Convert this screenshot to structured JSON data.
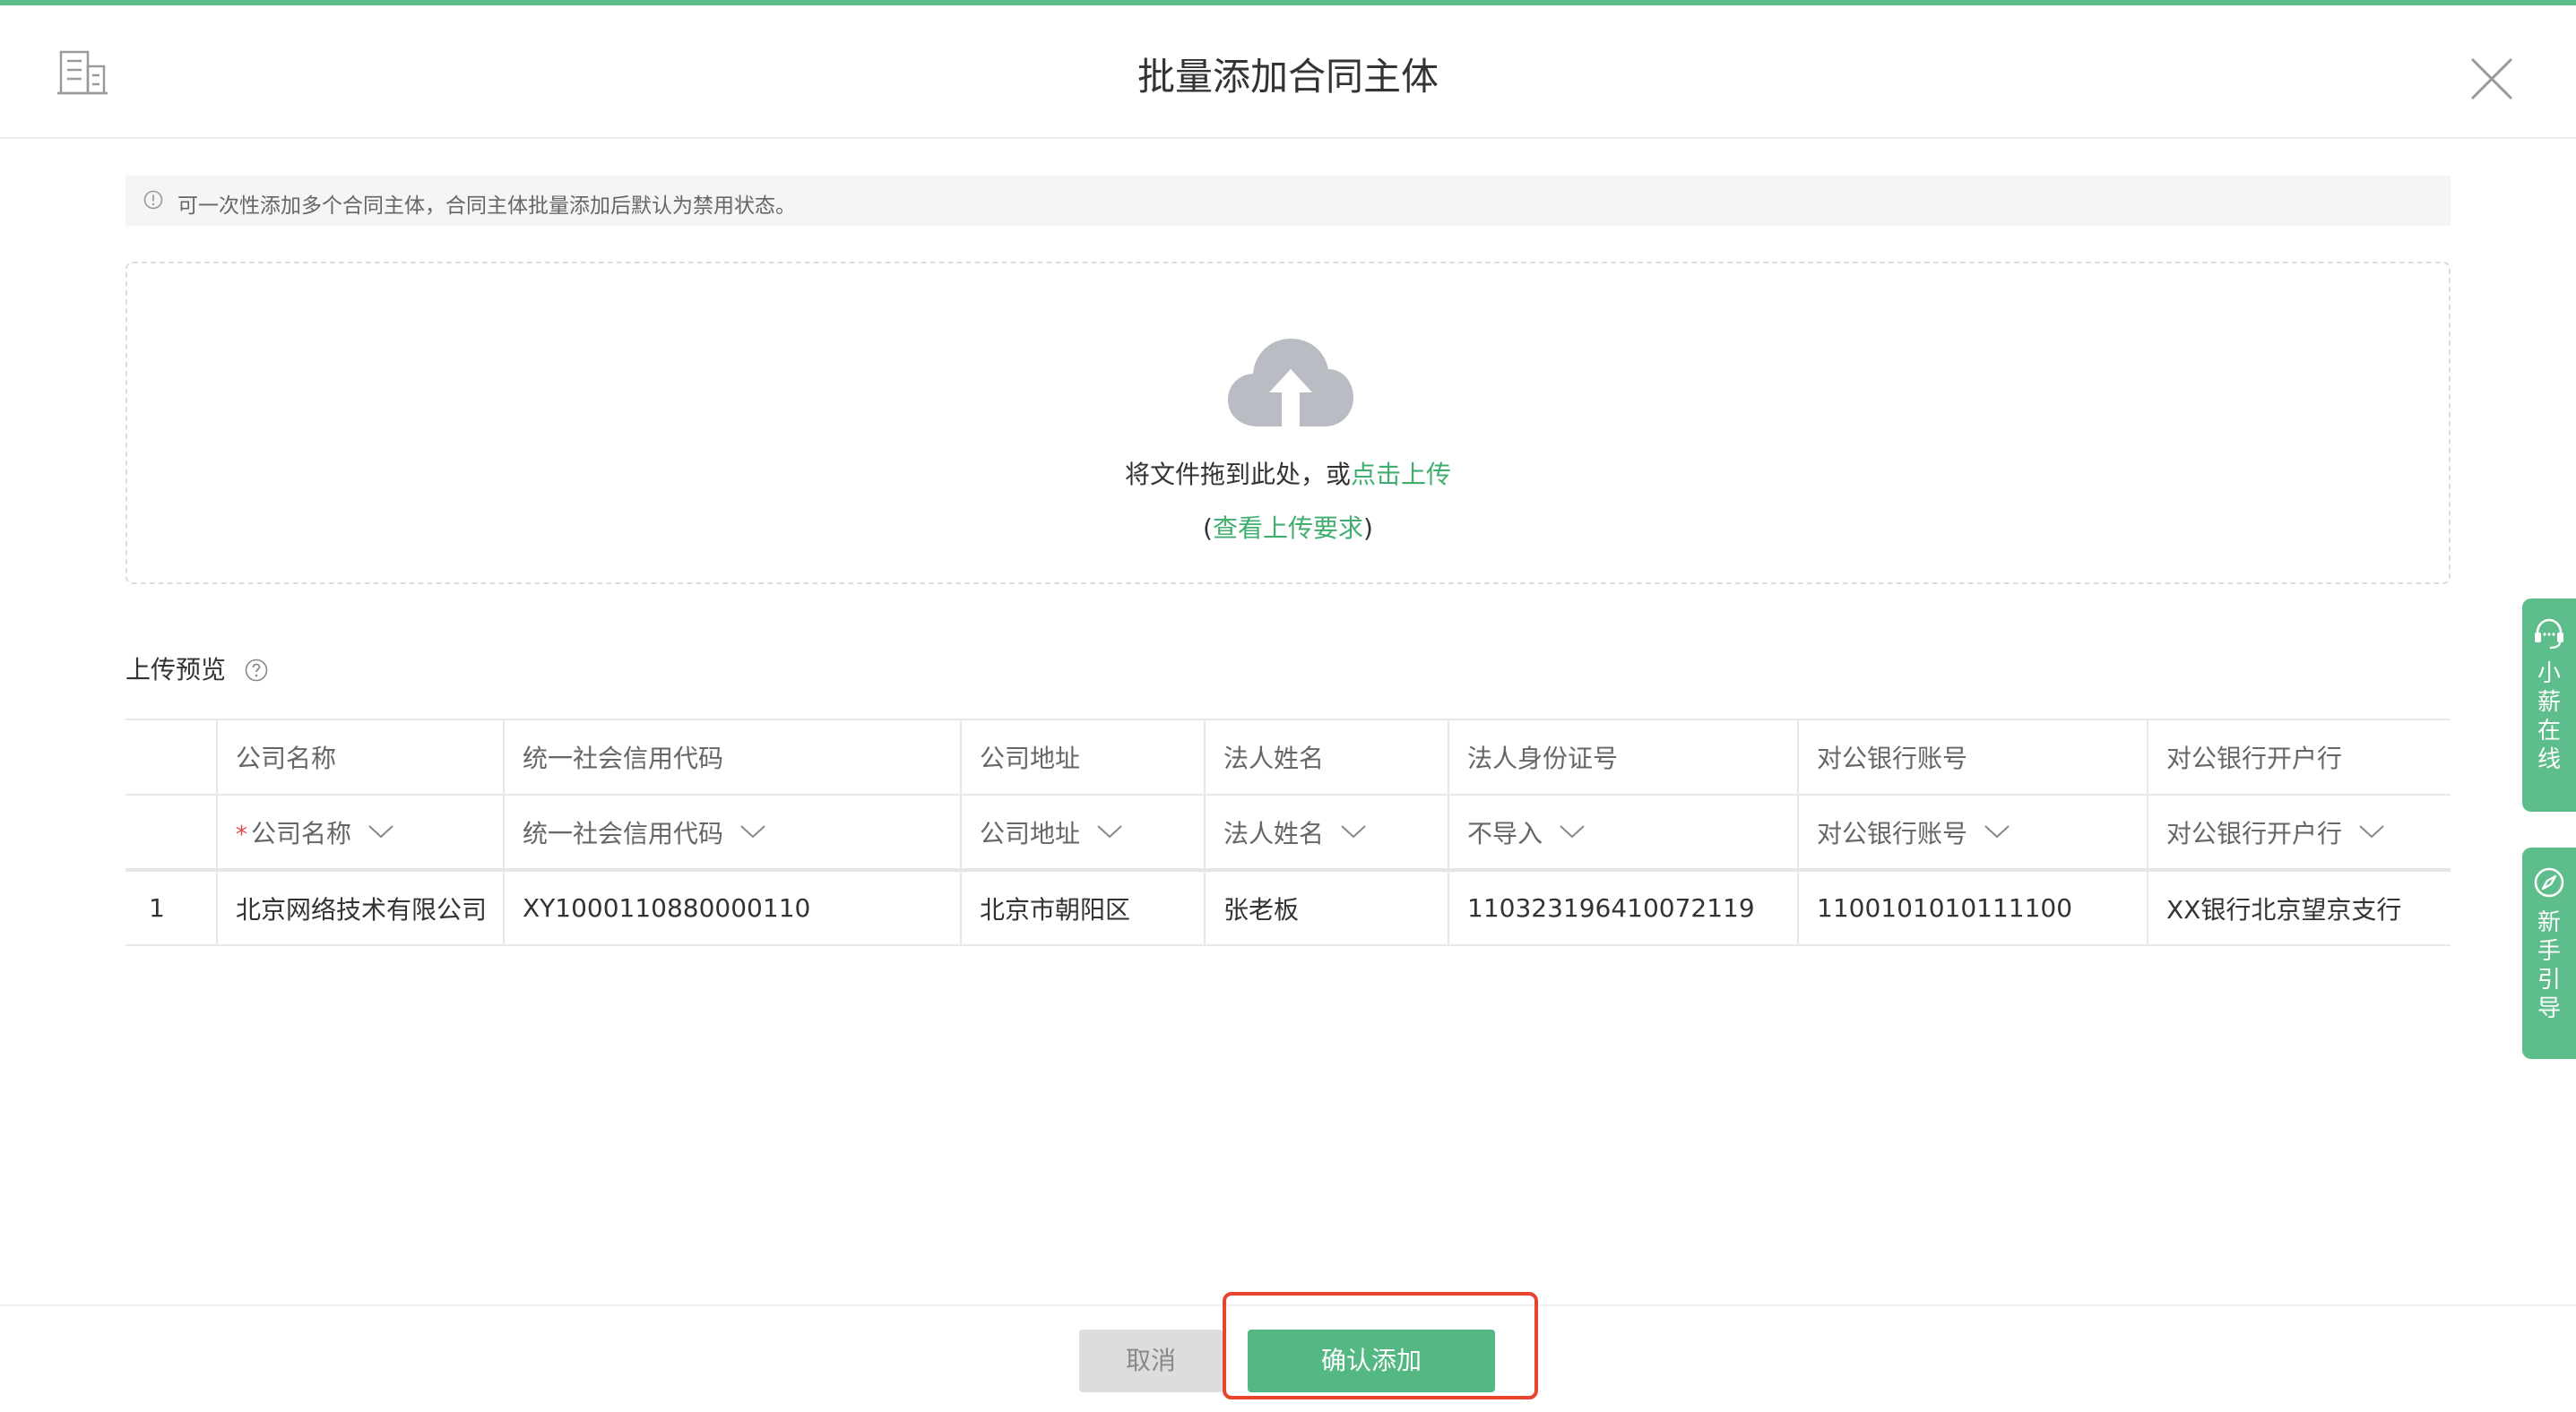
{
  "dialog": {
    "title": "批量添加合同主体"
  },
  "notice": {
    "text": "可一次性添加多个合同主体，合同主体批量添加后默认为禁用状态。"
  },
  "upload": {
    "drag_text": "将文件拖到此处，或",
    "click_link": "点击上传",
    "paren_open": "(",
    "requirements_link": "查看上传要求",
    "paren_close": ")"
  },
  "preview": {
    "label": "上传预览",
    "headers": [
      "公司名称",
      "统一社会信用代码",
      "公司地址",
      "法人姓名",
      "法人身份证号",
      "对公银行账号",
      "对公银行开户行"
    ],
    "mappings": [
      "公司名称",
      "统一社会信用代码",
      "公司地址",
      "法人姓名",
      "不导入",
      "对公银行账号",
      "对公银行开户行"
    ],
    "required_mark": "*",
    "rows": [
      {
        "index": "1",
        "cells": [
          "北京网络技术有限公司",
          "XY1000110880000110",
          "北京市朝阳区",
          "张老板",
          "110323196410072119",
          "1100101010111100",
          "XX银行北京望京支行"
        ]
      }
    ]
  },
  "footer": {
    "cancel_label": "取消",
    "confirm_label": "确认添加"
  },
  "side_tabs": [
    {
      "label": "小薪在线",
      "icon": "headset-icon"
    },
    {
      "label": "新手引导",
      "icon": "compass-icon"
    }
  ],
  "colors": {
    "accent": "#5dbd8b",
    "link": "#3fae6e",
    "highlight": "#e8452e"
  }
}
